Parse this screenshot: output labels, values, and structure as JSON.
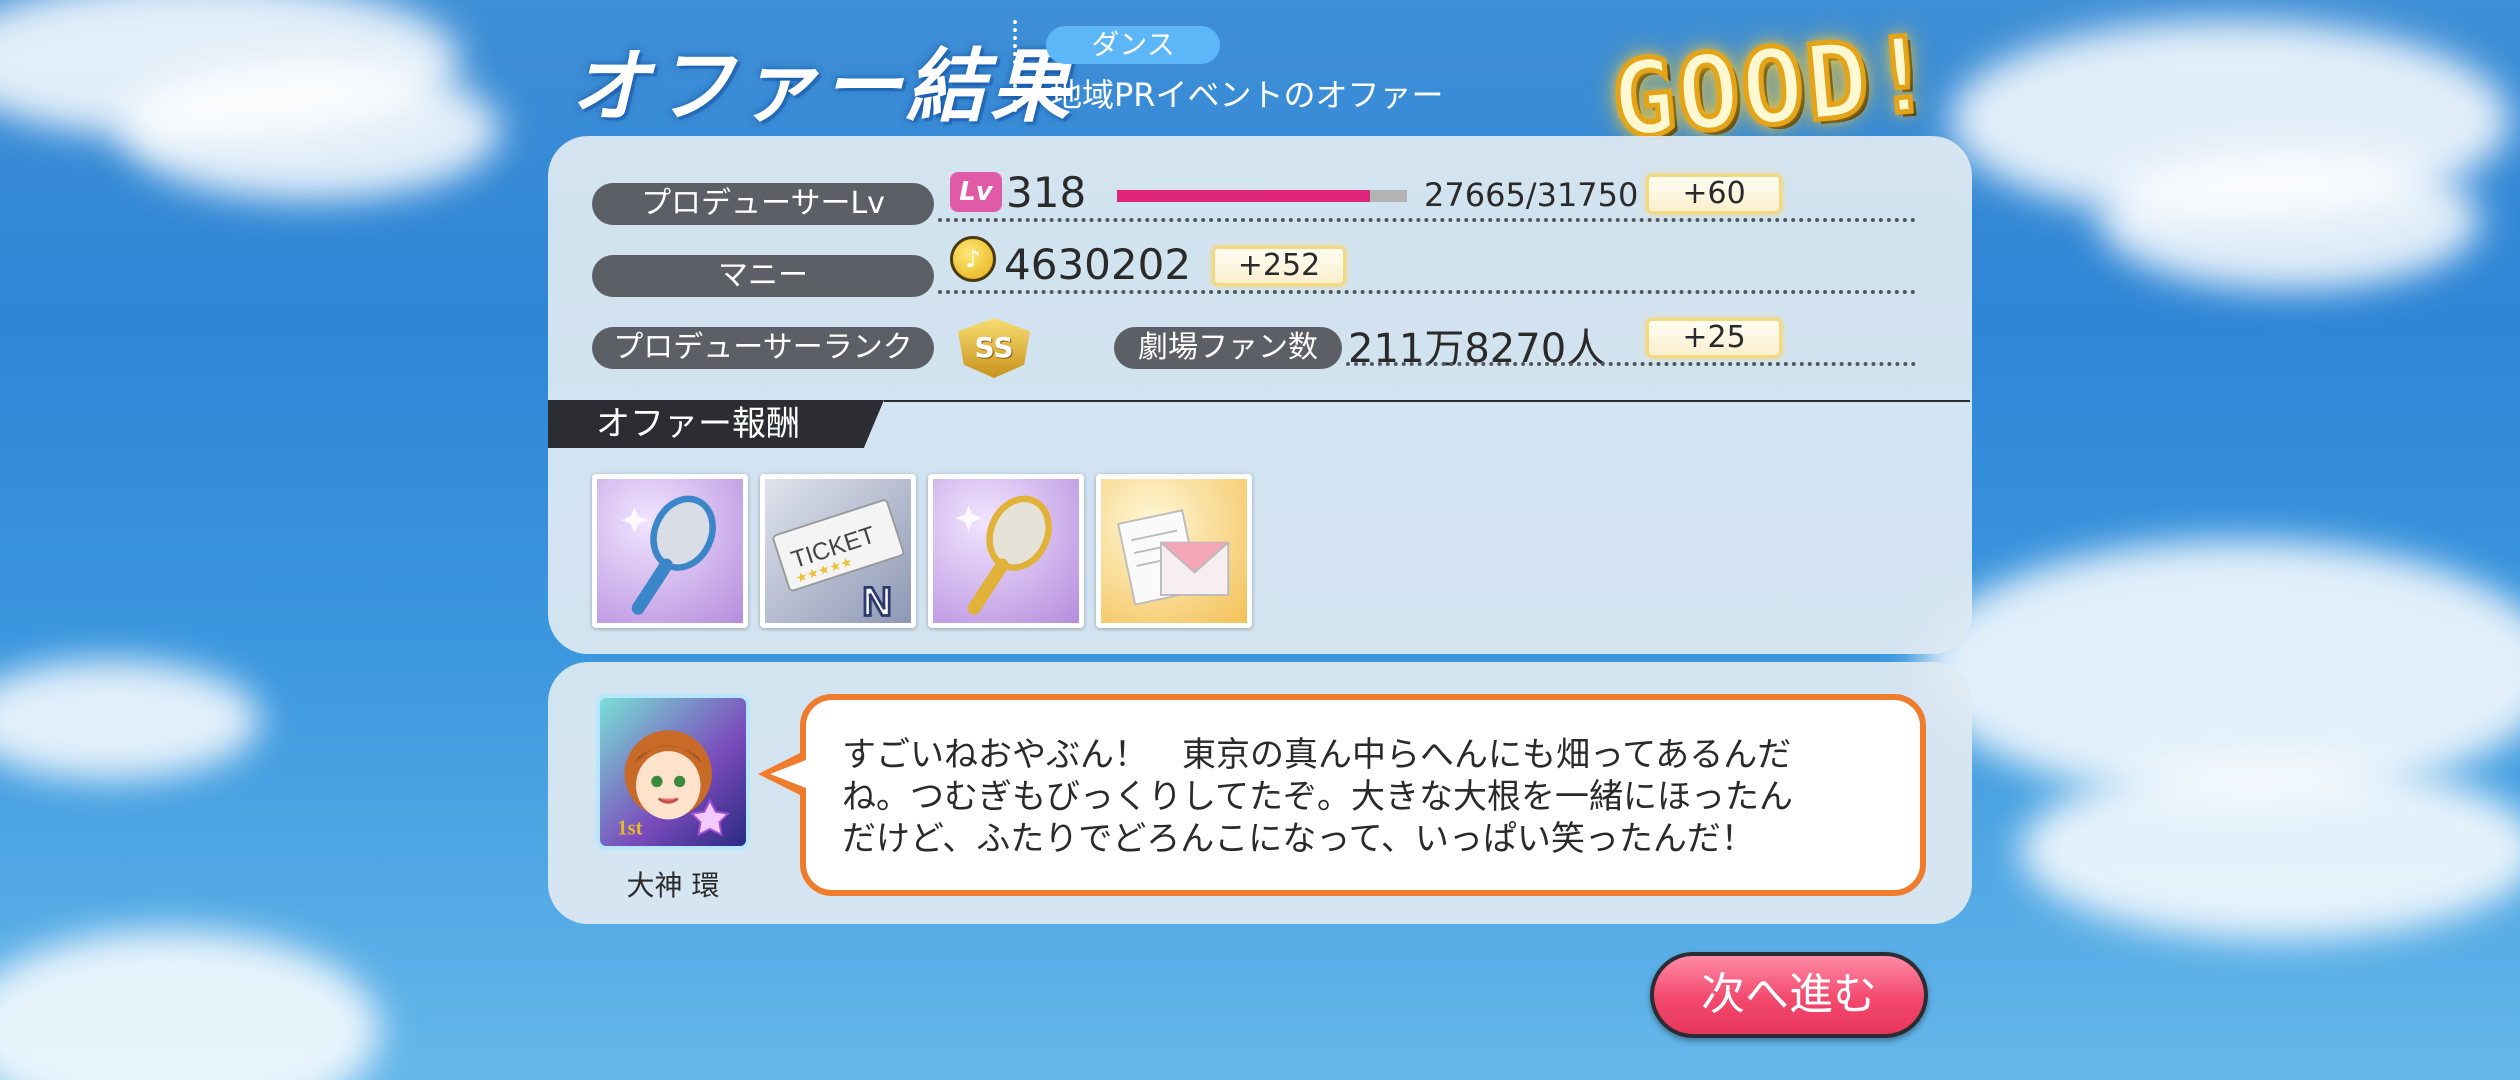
{
  "header": {
    "title": "オファー結果",
    "category": "ダンス",
    "offer_name": "地域PRイベントのオファー",
    "result": "GOOD!"
  },
  "stats": {
    "producer_lv": {
      "label": "プロデューサーLv",
      "icon": "Lv",
      "value": "318",
      "progress": "27665/31750",
      "progress_fraction": 0.871,
      "gain": "+60"
    },
    "money": {
      "label": "マニー",
      "value": "4630202",
      "gain": "+252"
    },
    "producer_rank": {
      "label": "プロデューサーランク",
      "rank": "SS"
    },
    "theater_fans": {
      "label": "劇場ファン数",
      "value": "211万8270人",
      "gain": "+25"
    }
  },
  "rewards": {
    "header": "オファー報酬",
    "items": [
      {
        "name": "silver-mirror-icon",
        "frame": "purple"
      },
      {
        "name": "ticket-n-icon",
        "frame": "silver",
        "ticket_text": "TICKET",
        "rarity": "N"
      },
      {
        "name": "gold-mirror-icon",
        "frame": "purple"
      },
      {
        "name": "letter-envelope-icon",
        "frame": "gold"
      }
    ]
  },
  "message": {
    "character_name": "大神 環",
    "avatar_badge": "1st",
    "lines": [
      "すごいねおやぶん！　東京の真ん中らへんにも畑ってあるんだ",
      "ね。つむぎもびっくりしてたぞ。大きな大根を一緒にほったん",
      "だけど、ふたりでどろんこになって、いっぱい笑ったんだ！"
    ]
  },
  "next_button": "次へ進む",
  "colors": {
    "xp_bar": "#dd2679",
    "next_button": "#f2496d",
    "bubble_border": "#f07b2c",
    "category_badge": "#5cb6f7"
  }
}
